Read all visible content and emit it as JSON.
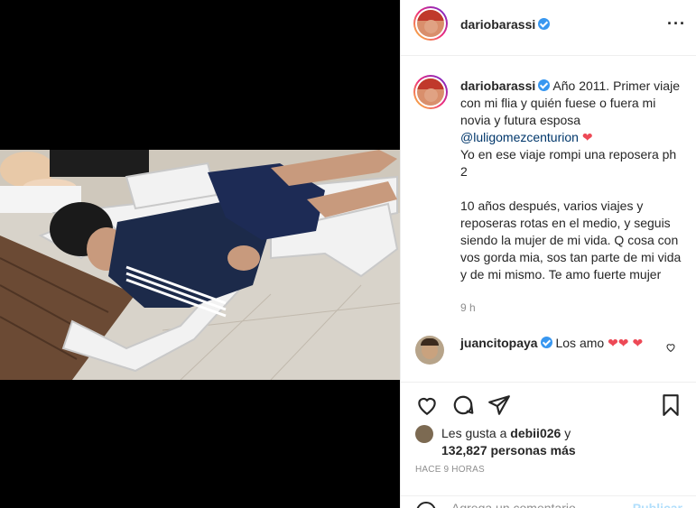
{
  "post": {
    "author": "dariobarassi",
    "more_icon": "more-horizontal-icon"
  },
  "caption": {
    "username": "dariobarassi",
    "line1": "Año 2011. Primer viaje con mi flia y quién fuese o fuera mi novia y futura esposa",
    "mention": "@luligomezcenturion",
    "line2": "Yo en ese viaje rompi una reposera ph 2",
    "line3": "10 años después, varios viajes y reposeras rotas en el medio, y seguis siendo la mujer de mi vida. Q cosa con vos gorda mia, sos tan parte de mi vida y de mi mismo. Te amo fuerte mujer",
    "time": "9 h"
  },
  "comment": {
    "username": "juancitopaya",
    "text": "Los amo"
  },
  "likes": {
    "prefix": "Les gusta a",
    "user": "debii026",
    "joiner": "y",
    "count": "132,827 personas más"
  },
  "ago": "HACE 9 HORAS",
  "add_comment": {
    "placeholder": "Agrega un comentario...",
    "publish": "Publicar"
  },
  "colors": {
    "verified": "#3897f0",
    "heart": "#ed4956",
    "mention": "#00376b",
    "publish": "#b2dffc"
  }
}
